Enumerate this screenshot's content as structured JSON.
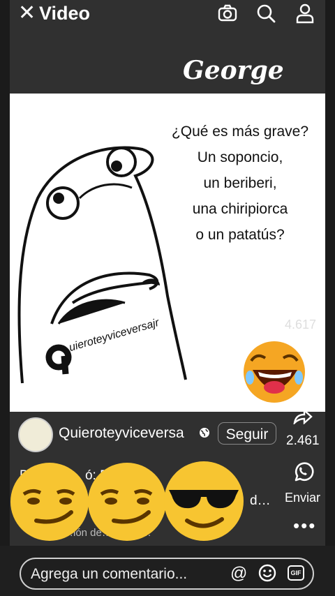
{
  "header": {
    "close_symbol": "✕",
    "title": "Video"
  },
  "post": {
    "overlay_name": "George",
    "question_lines": [
      "¿Qué es más grave?",
      "Un soponcio,",
      "un beriberi,",
      "una chiripiorca",
      "o un patatús?"
    ],
    "watermark": "uieroteyviceversajr",
    "logo_letter": "q"
  },
  "side": {
    "likes": "4.617",
    "shares": "2.461",
    "send_label": "Enviar",
    "more_label": "•••"
  },
  "account": {
    "name": "Quieroteyviceversa",
    "follow_label": "Seguir"
  },
  "description": {
    "line1": "D… stre… ó: P…   s xq",
    "line2": "d…",
    "line3": "…ión de…  es de…"
  },
  "comment": {
    "placeholder": "Agrega un comentario...",
    "at_symbol": "@",
    "gif_label": "GIF"
  },
  "icons": [
    "close-icon",
    "camera-icon",
    "search-icon",
    "profile-icon",
    "share-icon",
    "whatsapp-icon",
    "globe-icon",
    "emoji-icon",
    "gif-icon"
  ]
}
